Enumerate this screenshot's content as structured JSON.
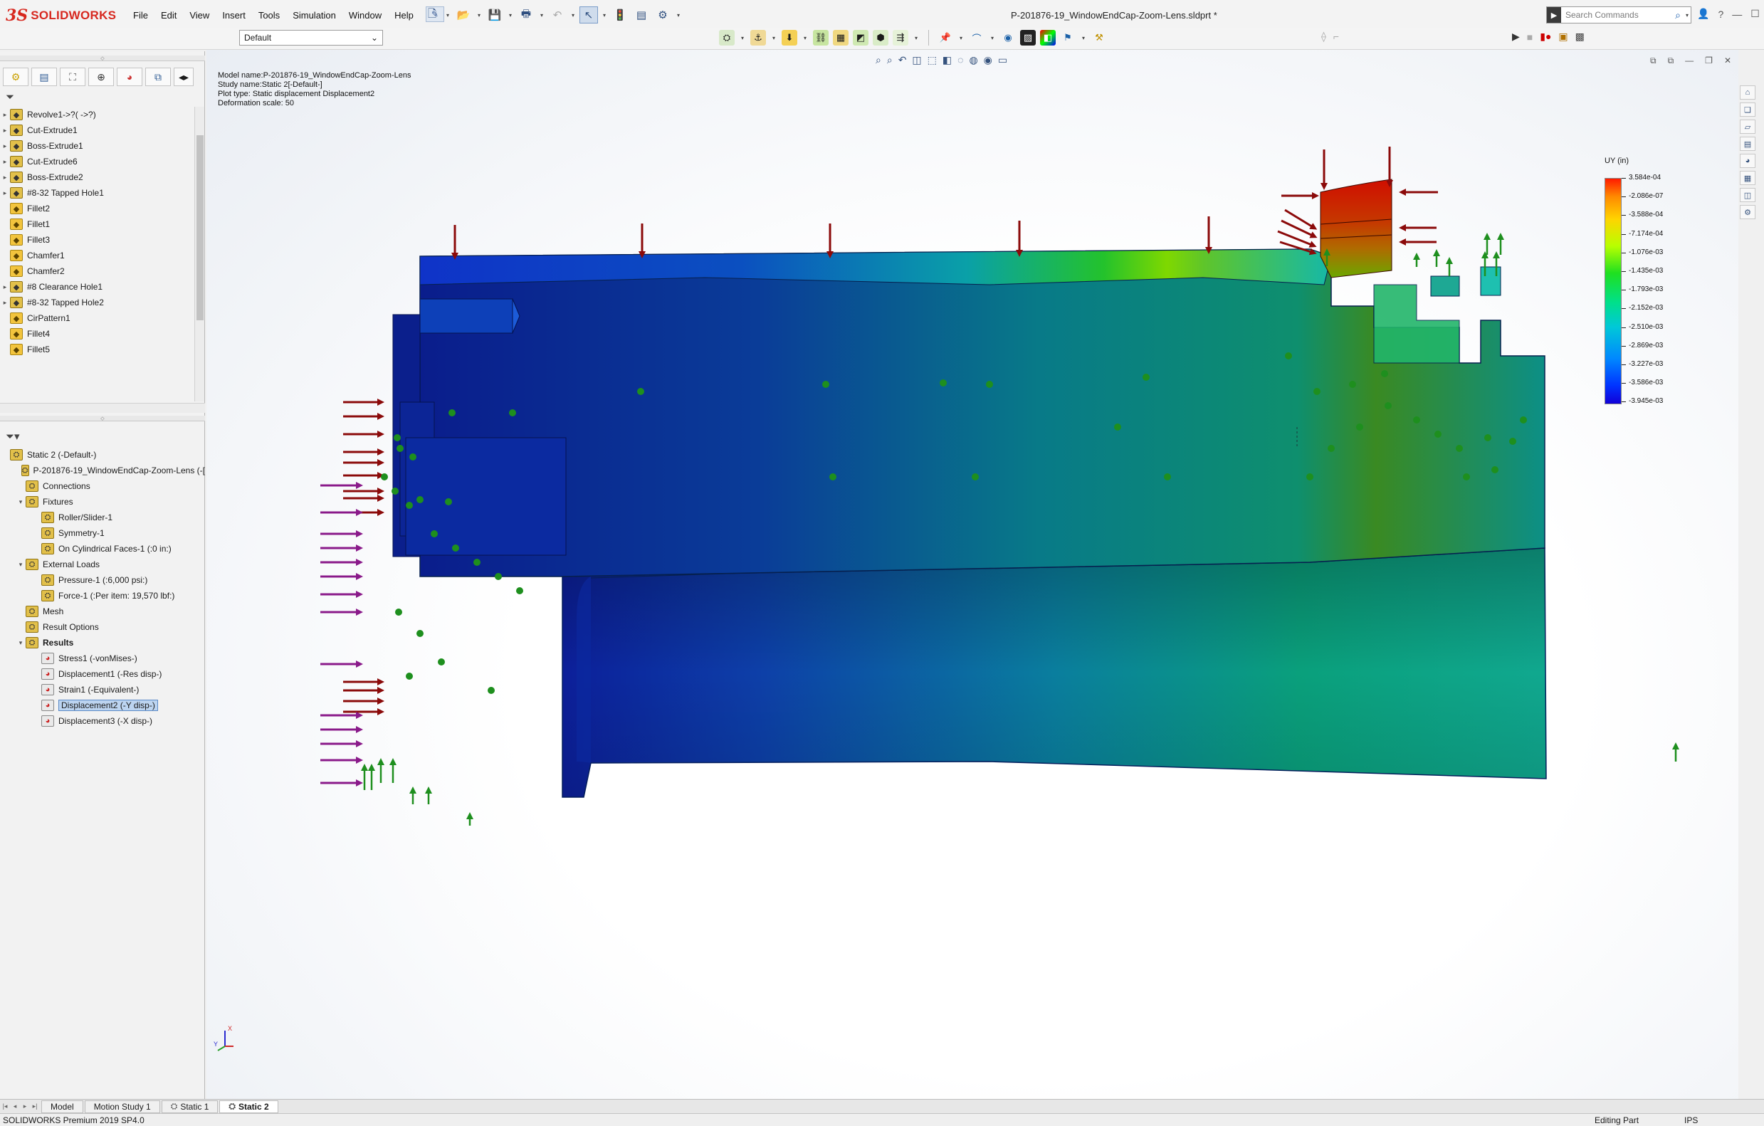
{
  "app": {
    "title": "P-201876-19_WindowEndCap-Zoom-Lens.sldprt *",
    "logo_prefix": "3S",
    "logo_text": "SOLIDWORKS",
    "menus": [
      "File",
      "Edit",
      "View",
      "Insert",
      "Tools",
      "Simulation",
      "Window",
      "Help"
    ],
    "search_placeholder": "Search Commands",
    "configuration": "Default"
  },
  "feature_tree": [
    {
      "label": "Revolve1->?( ->?)",
      "expandable": true,
      "icon": "revolve-icon"
    },
    {
      "label": "Cut-Extrude1",
      "expandable": true,
      "icon": "cut-extrude-icon"
    },
    {
      "label": "Boss-Extrude1",
      "expandable": true,
      "icon": "boss-extrude-icon"
    },
    {
      "label": "Cut-Extrude6",
      "expandable": true,
      "icon": "cut-extrude-icon"
    },
    {
      "label": "Boss-Extrude2",
      "expandable": true,
      "icon": "boss-extrude-icon"
    },
    {
      "label": "#8-32 Tapped Hole1",
      "expandable": true,
      "icon": "hole-icon"
    },
    {
      "label": "Fillet2",
      "expandable": false,
      "icon": "fillet-icon"
    },
    {
      "label": "Fillet1",
      "expandable": false,
      "icon": "fillet-icon"
    },
    {
      "label": "Fillet3",
      "expandable": false,
      "icon": "fillet-icon"
    },
    {
      "label": "Chamfer1",
      "expandable": false,
      "icon": "chamfer-icon"
    },
    {
      "label": "Chamfer2",
      "expandable": false,
      "icon": "chamfer-icon"
    },
    {
      "label": "#8 Clearance Hole1",
      "expandable": true,
      "icon": "hole-icon"
    },
    {
      "label": "#8-32 Tapped Hole2",
      "expandable": true,
      "icon": "hole-icon"
    },
    {
      "label": "CirPattern1",
      "expandable": false,
      "icon": "pattern-icon"
    },
    {
      "label": "Fillet4",
      "expandable": false,
      "icon": "fillet-icon"
    },
    {
      "label": "Fillet5",
      "expandable": false,
      "icon": "fillet-icon"
    }
  ],
  "study_tree": [
    {
      "label": "Static 2 (-Default-)",
      "indent": 0,
      "toggle": "",
      "icon": "study-icon"
    },
    {
      "label": "P-201876-19_WindowEndCap-Zoom-Lens (-[",
      "indent": 1,
      "toggle": "",
      "icon": "part-icon"
    },
    {
      "label": "Connections",
      "indent": 1,
      "toggle": "",
      "icon": "connections-icon"
    },
    {
      "label": "Fixtures",
      "indent": 1,
      "toggle": "▾",
      "icon": "fixtures-icon"
    },
    {
      "label": "Roller/Slider-1",
      "indent": 2,
      "toggle": "",
      "icon": "roller-slider-icon"
    },
    {
      "label": "Symmetry-1",
      "indent": 2,
      "toggle": "",
      "icon": "symmetry-icon"
    },
    {
      "label": "On Cylindrical Faces-1 (:0 in:)",
      "indent": 2,
      "toggle": "",
      "icon": "cylindrical-fixture-icon"
    },
    {
      "label": "External Loads",
      "indent": 1,
      "toggle": "▾",
      "icon": "external-loads-icon"
    },
    {
      "label": "Pressure-1 (:6,000 psi:)",
      "indent": 2,
      "toggle": "",
      "icon": "pressure-icon"
    },
    {
      "label": "Force-1 (:Per item: 19,570 lbf:)",
      "indent": 2,
      "toggle": "",
      "icon": "force-icon"
    },
    {
      "label": "Mesh",
      "indent": 1,
      "toggle": "",
      "icon": "mesh-icon"
    },
    {
      "label": "Result Options",
      "indent": 1,
      "toggle": "",
      "icon": "result-options-icon"
    },
    {
      "label": "Results",
      "indent": 1,
      "toggle": "▾",
      "icon": "results-folder-icon",
      "bold": true
    },
    {
      "label": "Stress1 (-vonMises-)",
      "indent": 2,
      "toggle": "",
      "icon": "plot-icon"
    },
    {
      "label": "Displacement1 (-Res disp-)",
      "indent": 2,
      "toggle": "",
      "icon": "plot-icon"
    },
    {
      "label": "Strain1 (-Equivalent-)",
      "indent": 2,
      "toggle": "",
      "icon": "plot-icon"
    },
    {
      "label": "Displacement2 (-Y disp-)",
      "indent": 2,
      "toggle": "",
      "icon": "plot-icon",
      "selected": true
    },
    {
      "label": "Displacement3 (-X disp-)",
      "indent": 2,
      "toggle": "",
      "icon": "plot-icon"
    }
  ],
  "study_info": {
    "line1": "Model name:P-201876-19_WindowEndCap-Zoom-Lens",
    "line2": "Study name:Static 2[-Default-]",
    "line3": "Plot type: Static displacement Displacement2",
    "line4": "Deformation scale: 50"
  },
  "legend": {
    "title": "UY (in)",
    "ticks": [
      "3.584e-04",
      "-2.086e-07",
      "-3.588e-04",
      "-7.174e-04",
      "-1.076e-03",
      "-1.435e-03",
      "-1.793e-03",
      "-2.152e-03",
      "-2.510e-03",
      "-2.869e-03",
      "-3.227e-03",
      "-3.586e-03",
      "-3.945e-03"
    ]
  },
  "triad": {
    "x": "X",
    "y": "Y"
  },
  "bottom_tabs": [
    "Model",
    "Motion Study 1",
    "Static 1",
    "Static 2"
  ],
  "active_tab": "Static 2",
  "status": {
    "left": "SOLIDWORKS Premium 2019 SP4.0",
    "mode": "Editing Part",
    "units": "IPS"
  },
  "colors": {
    "brand": "#d7281f",
    "load_arrow": "#8b0a0a",
    "pressure_arrow": "#8a1a8a",
    "fixture": "#1e8f1e"
  }
}
